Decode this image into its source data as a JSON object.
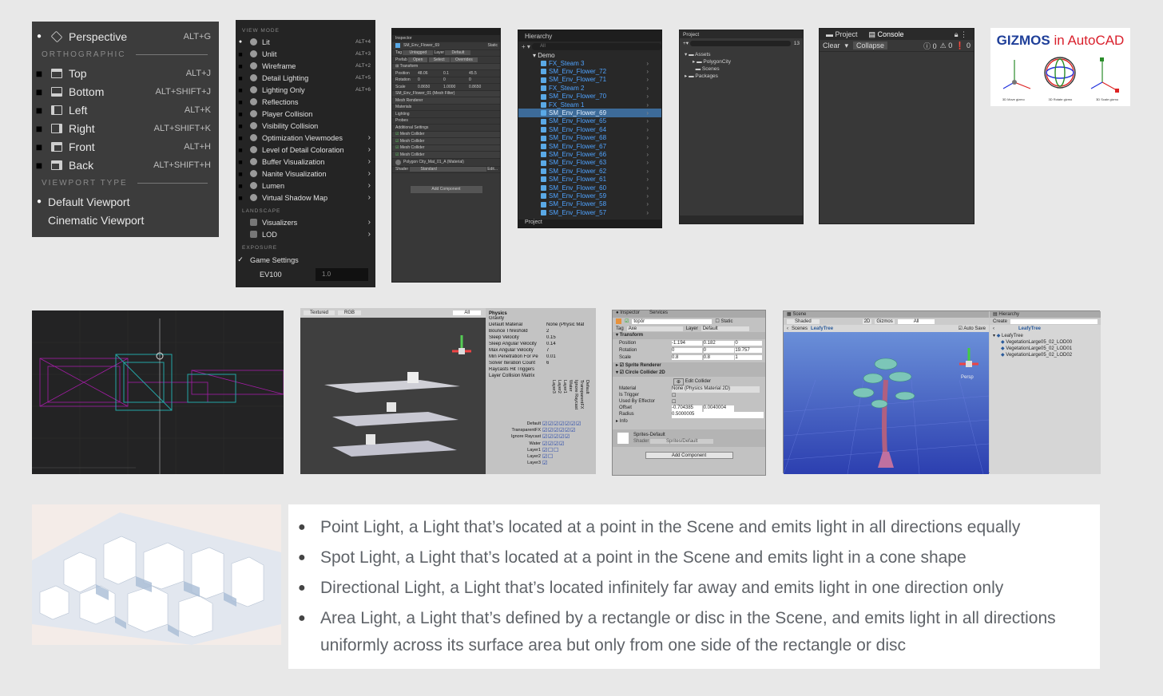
{
  "viewport_menu": {
    "perspective": {
      "label": "Perspective",
      "shortcut": "ALT+G"
    },
    "orthographic_header": "ORTHOGRAPHIC",
    "ortho_items": [
      {
        "label": "Top",
        "shortcut": "ALT+J"
      },
      {
        "label": "Bottom",
        "shortcut": "ALT+SHIFT+J"
      },
      {
        "label": "Left",
        "shortcut": "ALT+K"
      },
      {
        "label": "Right",
        "shortcut": "ALT+SHIFT+K"
      },
      {
        "label": "Front",
        "shortcut": "ALT+H"
      },
      {
        "label": "Back",
        "shortcut": "ALT+SHIFT+H"
      }
    ],
    "viewport_type_header": "VIEWPORT TYPE",
    "type_items": [
      {
        "label": "Default Viewport"
      },
      {
        "label": "Cinematic Viewport"
      }
    ]
  },
  "view_mode_menu": {
    "header": "VIEW MODE",
    "items": [
      {
        "label": "Lit",
        "shortcut": "ALT+4"
      },
      {
        "label": "Unlit",
        "shortcut": "ALT+3"
      },
      {
        "label": "Wireframe",
        "shortcut": "ALT+2"
      },
      {
        "label": "Detail Lighting",
        "shortcut": "ALT+5"
      },
      {
        "label": "Lighting Only",
        "shortcut": "ALT+6"
      },
      {
        "label": "Reflections",
        "shortcut": ""
      },
      {
        "label": "Player Collision",
        "shortcut": ""
      },
      {
        "label": "Visibility Collision",
        "shortcut": ""
      },
      {
        "label": "Optimization Viewmodes",
        "shortcut": ""
      },
      {
        "label": "Level of Detail Coloration",
        "shortcut": ""
      },
      {
        "label": "Buffer Visualization",
        "shortcut": ""
      },
      {
        "label": "Nanite Visualization",
        "shortcut": ""
      },
      {
        "label": "Lumen",
        "shortcut": ""
      },
      {
        "label": "Virtual Shadow Map",
        "shortcut": ""
      }
    ],
    "landscape_header": "LANDSCAPE",
    "landscape_items": [
      {
        "label": "Visualizers"
      },
      {
        "label": "LOD"
      }
    ],
    "exposure_header": "EXPOSURE",
    "game_settings": "Game Settings",
    "ev100_label": "EV100",
    "ev100_value": "1.0"
  },
  "inspector": {
    "tab": "Inspector",
    "object_name": "SM_Env_Flower_69",
    "static": "Static",
    "tag_label": "Tag",
    "tag_value": "Untagged",
    "layer_label": "Layer",
    "layer_value": "Default",
    "prefab": "Prefab",
    "open": "Open",
    "select": "Select",
    "overrides": "Overrides",
    "transform": "Transform",
    "position": "Position",
    "rotation": "Rotation",
    "scale": "Scale",
    "pos_values": [
      "48.06",
      "0.1",
      "45.5"
    ],
    "rot_values": [
      "0",
      "0",
      "0"
    ],
    "scale_values": [
      "0.8650",
      "1.0000",
      "0.8650"
    ],
    "mesh_filter": "SM_Env_Flower_01 (Mesh Filter)",
    "mesh_renderer": "Mesh Renderer",
    "materials": "Materials",
    "lighting": "Lighting",
    "probes": "Probes",
    "additional": "Additional Settings",
    "colliders": [
      "Mesh Collider",
      "Mesh Collider",
      "Mesh Collider",
      "Mesh Collider"
    ],
    "material_name": "Polygon City_Mat_01_A (Material)",
    "shader_label": "Shader",
    "shader_value": "Standard",
    "edit": "Edit...",
    "add_component": "Add Component"
  },
  "hierarchy": {
    "tab": "Hierarchy",
    "search_placeholder": "All",
    "root": "Demo",
    "items": [
      "FX_Steam 3",
      "SM_Env_Flower_72",
      "SM_Env_Flower_71",
      "FX_Steam 2",
      "SM_Env_Flower_70",
      "FX_Steam 1",
      "SM_Env_Flower_69",
      "SM_Env_Flower_65",
      "SM_Env_Flower_64",
      "SM_Env_Flower_68",
      "SM_Env_Flower_67",
      "SM_Env_Flower_66",
      "SM_Env_Flower_63",
      "SM_Env_Flower_62",
      "SM_Env_Flower_61",
      "SM_Env_Flower_60",
      "SM_Env_Flower_59",
      "SM_Env_Flower_58",
      "SM_Env_Flower_57"
    ],
    "selected_index": 6,
    "bottom_tab": "Project"
  },
  "project": {
    "tab": "Project",
    "tree": [
      "Assets",
      "PolygonCity",
      "Scenes",
      "Packages"
    ],
    "badge": "13"
  },
  "console": {
    "tabs": [
      "Project",
      "Console"
    ],
    "clear": "Clear",
    "collapse": "Collapse",
    "counts": [
      "0",
      "0",
      "0"
    ]
  },
  "gizmos": {
    "title_part1": "GIZMOS",
    "title_part2": " in ",
    "title_part3": "AutoCAD",
    "captions": [
      "3D Move gizmo",
      "3D Rotate gizmo",
      "3D Scale gizmo"
    ],
    "colors": {
      "title_blue": "#1f3f99",
      "title_red": "#d9202c"
    }
  },
  "physics": {
    "toolbar": [
      "Textured",
      "RGB"
    ],
    "search": "All",
    "header": "Physics",
    "props": [
      {
        "label": "Gravity",
        "value": ""
      },
      {
        "label": "Default Material",
        "value": "None (Physic Mat"
      },
      {
        "label": "Bounce Threshold",
        "value": "2"
      },
      {
        "label": "Sleep Velocity",
        "value": "0.15"
      },
      {
        "label": "Sleep Angular Velocity",
        "value": "0.14"
      },
      {
        "label": "Max Angular Velocity",
        "value": "7"
      },
      {
        "label": "Min Penetration For Pe",
        "value": "0.01"
      },
      {
        "label": "Solver Iteration Count",
        "value": "6"
      },
      {
        "label": "Raycasts Hit Triggers",
        "value": ""
      }
    ],
    "matrix_header": "Layer Collision Matrix",
    "matrix_cols": [
      "Default",
      "TransparentFX",
      "Ignore Raycast",
      "Water",
      "Layer1",
      "Layer2",
      "Layer3"
    ],
    "matrix_rows": [
      "Default",
      "TransparentFX",
      "Ignore Raycast",
      "Water",
      "Layer1",
      "Layer2",
      "Layer3"
    ]
  },
  "inspector2d": {
    "tabs": [
      "Inspector",
      "Services"
    ],
    "name": "topór",
    "static": "Static",
    "tag_label": "Tag",
    "tag_value": "Axe",
    "layer_label": "Layer",
    "layer_value": "Default",
    "transform": "Transform",
    "position": {
      "label": "Position",
      "x": "-1.194",
      "y": "0.182",
      "z": "0"
    },
    "rotation": {
      "label": "Rotation",
      "x": "0",
      "y": "0",
      "z": "19.757"
    },
    "scale": {
      "label": "Scale",
      "x": "0.8",
      "y": "0.8",
      "z": "1"
    },
    "sprite_renderer": "Sprite Renderer",
    "circle_collider": "Circle Collider 2D",
    "edit_collider": "Edit Collider",
    "material": {
      "label": "Material",
      "value": "None (Physics Material 2D)"
    },
    "is_trigger": "Is Trigger",
    "used_by_effector": "Used By Effector",
    "offset": {
      "label": "Offset",
      "x": "-0.704385",
      "y": "0.0040004"
    },
    "radius": {
      "label": "Radius",
      "value": "0.5000005"
    },
    "info": "Info",
    "sprite_material": "Sprites-Default",
    "shader_label": "Shader",
    "shader_value": "Sprites/Default",
    "add_component": "Add Component"
  },
  "scene": {
    "tab": "Scene",
    "shading": "Shaded",
    "mode": "2D",
    "gizmos": "Gizmos",
    "search": "All",
    "breadcrumb_root": "Scenes",
    "breadcrumb_item": "LeafyTree",
    "auto_save": "Auto Save",
    "persp": "Persp",
    "hierarchy_tab": "Hierarchy",
    "create": "Create",
    "hierarchy_root": "LeafyTree",
    "hierarchy_items": [
      "LeafyTree",
      "VegetationLarge05_02_LOD00",
      "VegetationLarge05_02_LOD01",
      "VegetationLarge05_02_LOD02"
    ]
  },
  "lights": {
    "items": [
      "Point Light, a Light that’s located at a point in the Scene and emits light in all directions equally",
      "Spot Light, a Light that’s located at a point in the Scene and emits light in a cone shape",
      "Directional Light, a Light that’s located infinitely far away and emits light in one direction only",
      "Area Light, a Light that’s defined by a rectangle or disc in the Scene, and emits light in all directions uniformly across its surface area but only from one side of the rectangle or disc"
    ]
  }
}
